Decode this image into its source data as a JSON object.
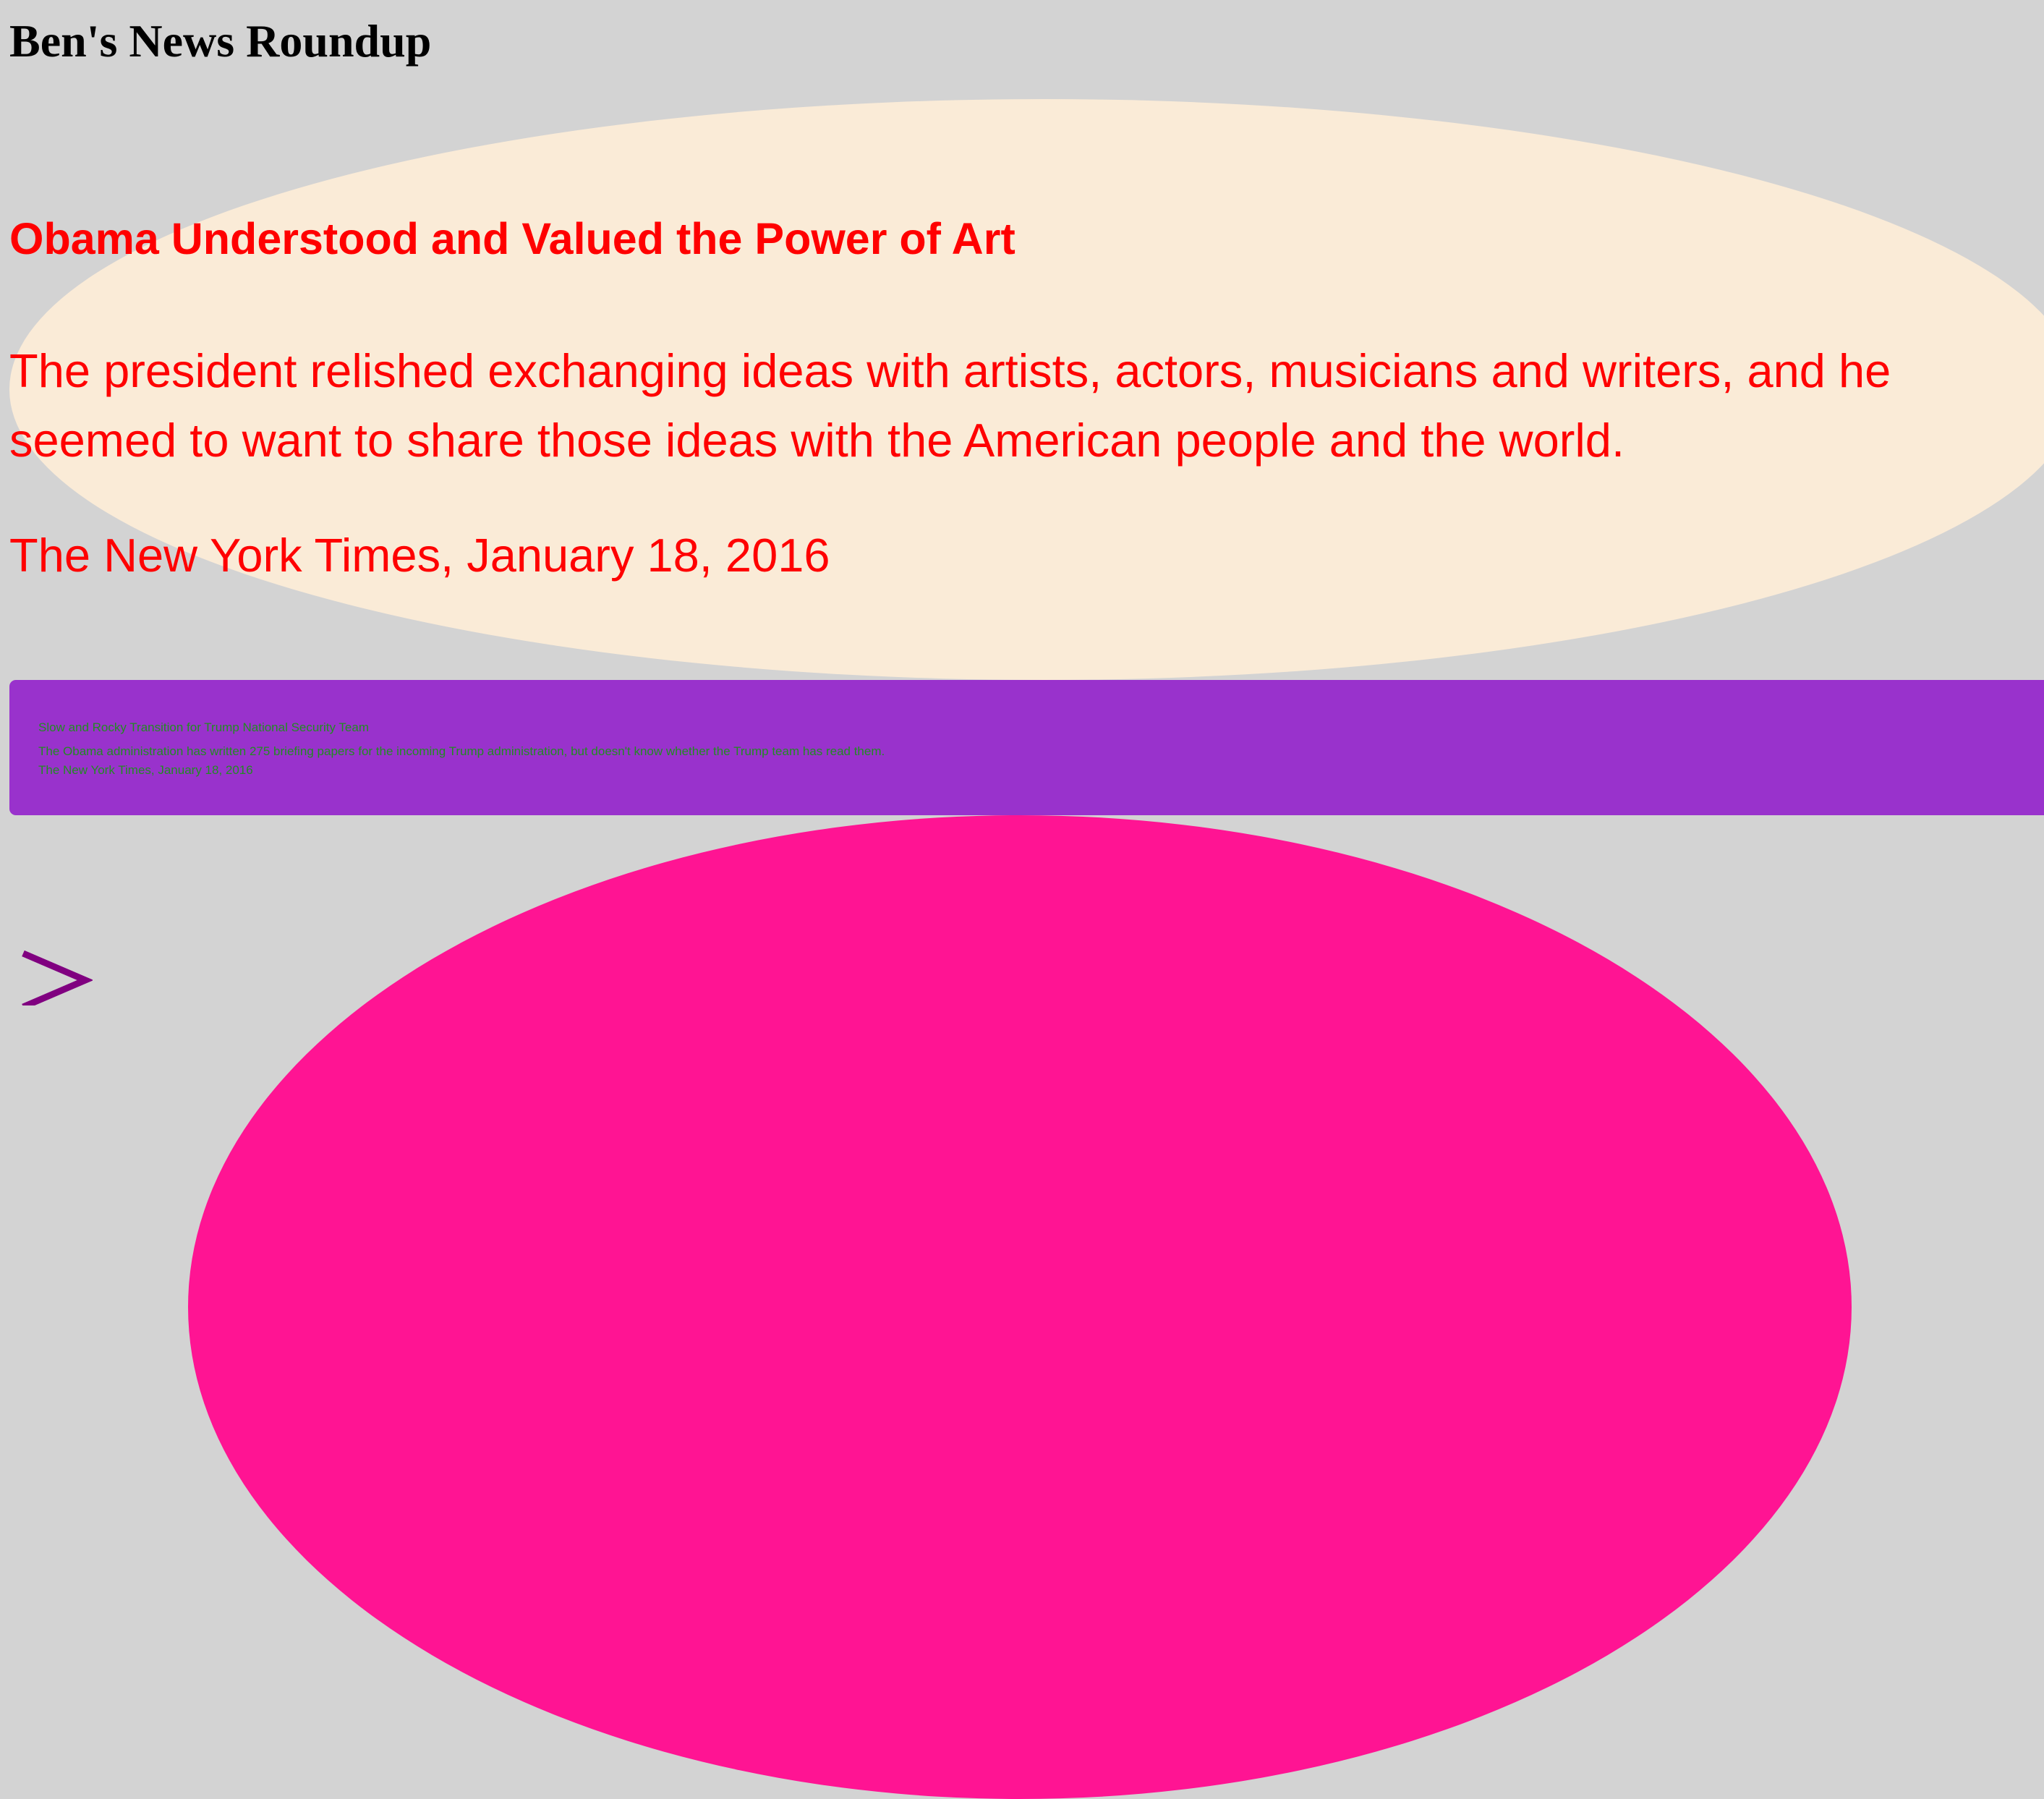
{
  "page": {
    "title": "Ben's News Roundup",
    "background_color": "#d3d3d3"
  },
  "featured_story": {
    "headline": "Obama Understood and Valued the Power of Art",
    "summary": "The president relished exchanging ideas with artists, actors, musicians and writers, and he seemed to want to share those ideas with the American people and the world.",
    "source": "The New York Times, January 18, 2016",
    "card_color": "#faebd7",
    "text_color": "#ff0000"
  },
  "secondary_story": {
    "headline": "Slow and Rocky Transition for Trump National Security Team",
    "summary": "The Obama administration has written 275 briefing papers for the incoming Trump administration, but doesn't know whether the Trump team has read them.",
    "source": "The New York Times, January 18, 2016",
    "card_color": "#9932cc",
    "text_color": "#228b22"
  },
  "tertiary_card": {
    "card_color": "#ff1493"
  },
  "navigation": {
    "next_icon": "chevron-right-icon",
    "icon_color": "#800080"
  }
}
